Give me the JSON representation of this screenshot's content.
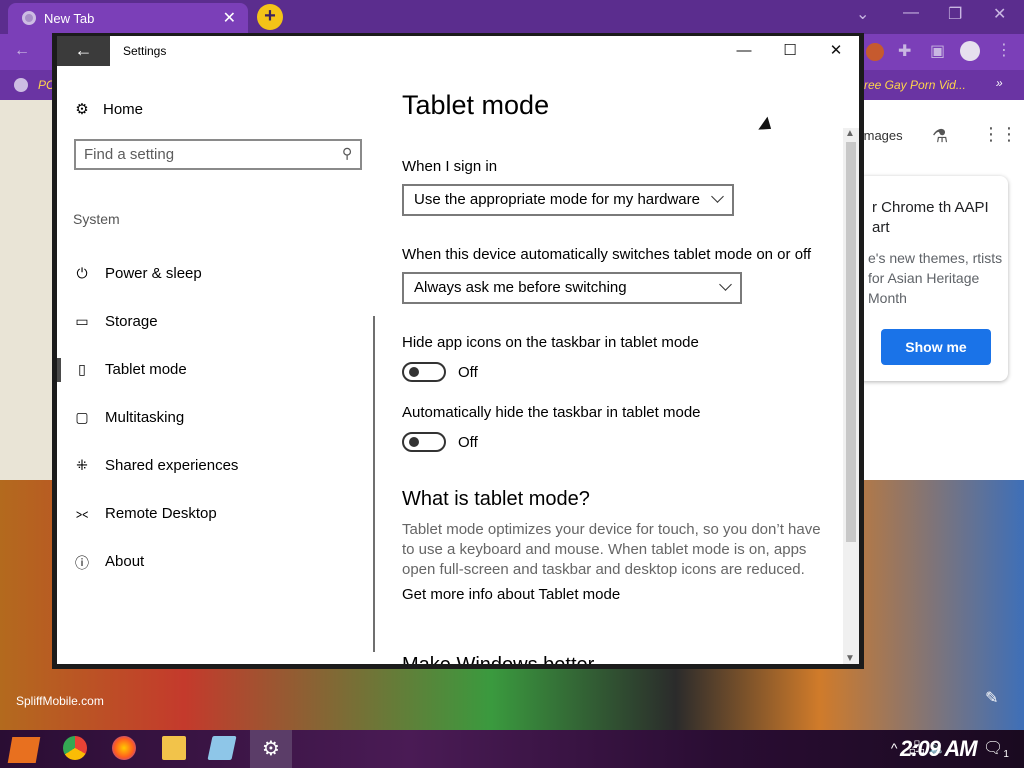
{
  "browser": {
    "tab_title": "New Tab",
    "tab_close": "✕",
    "new_tab": "+",
    "bookmark_left": "PC",
    "bookmark_right": "ree Gay Porn Vid...",
    "images_link": "Images",
    "promo": {
      "title": "r Chrome th AAPI art",
      "body": "e's new themes, rtists for Asian Heritage Month",
      "button": "Show me"
    },
    "watermark": "SpliffMobile.com"
  },
  "taskbar": {
    "clock": "2:09 AM",
    "notification_count": "1"
  },
  "settings": {
    "window_title": "Settings",
    "back_glyph": "←",
    "controls": {
      "minimize": "—",
      "maximize": "☐",
      "close": "✕"
    },
    "nav": {
      "home": "Home",
      "search_placeholder": "Find a setting",
      "section": "System",
      "items": [
        {
          "label": "Power & sleep",
          "icon": "power-icon"
        },
        {
          "label": "Storage",
          "icon": "storage-icon"
        },
        {
          "label": "Tablet mode",
          "icon": "tablet-mode-icon",
          "selected": true
        },
        {
          "label": "Multitasking",
          "icon": "multitasking-icon"
        },
        {
          "label": "Shared experiences",
          "icon": "shared-experiences-icon"
        },
        {
          "label": "Remote Desktop",
          "icon": "remote-desktop-icon"
        },
        {
          "label": "About",
          "icon": "info-icon"
        }
      ]
    },
    "main": {
      "title": "Tablet mode",
      "signin_label": "When I sign in",
      "signin_value": "Use the appropriate mode for my hardware",
      "switch_label": "When this device automatically switches tablet mode on or off",
      "switch_value": "Always ask me before switching",
      "hide_icons_label": "Hide app icons on the taskbar in tablet mode",
      "hide_icons_state": "Off",
      "hide_taskbar_label": "Automatically hide the taskbar in tablet mode",
      "hide_taskbar_state": "Off",
      "what_heading": "What is tablet mode?",
      "what_desc": "Tablet mode optimizes your device for touch, so you don’t have to use a keyboard and mouse. When tablet mode is on, apps open full-screen and taskbar and desktop icons are reduced.",
      "more_link": "Get more info about Tablet mode",
      "cut_heading": "Make Windows better"
    }
  }
}
